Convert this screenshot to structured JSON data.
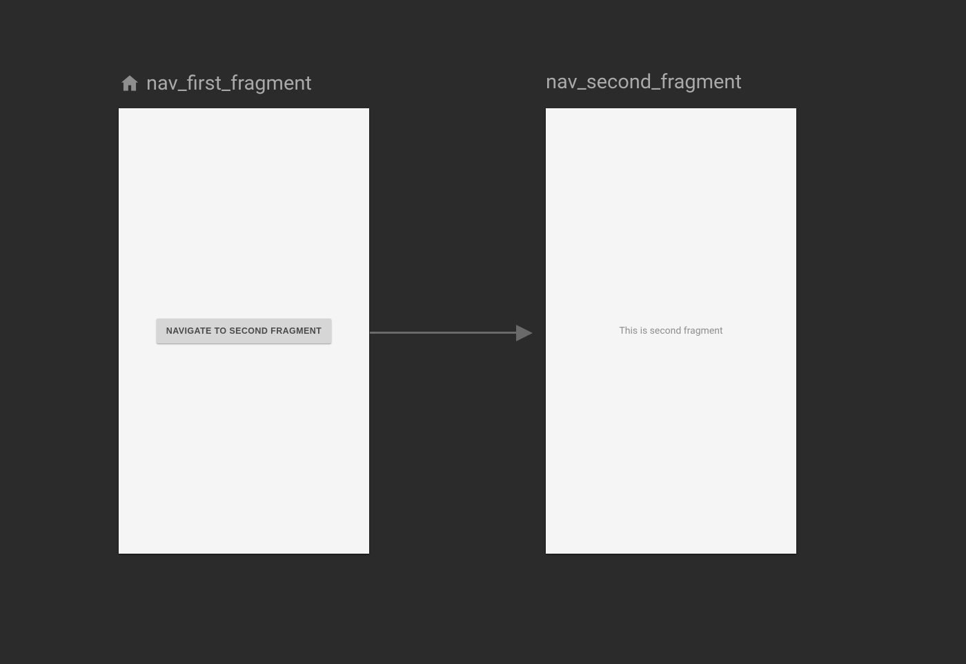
{
  "first_fragment": {
    "title": "nav_first_fragment",
    "button_label": "NAVIGATE TO SECOND FRAGMENT"
  },
  "second_fragment": {
    "title": "nav_second_fragment",
    "body_text": "This is second fragment"
  }
}
